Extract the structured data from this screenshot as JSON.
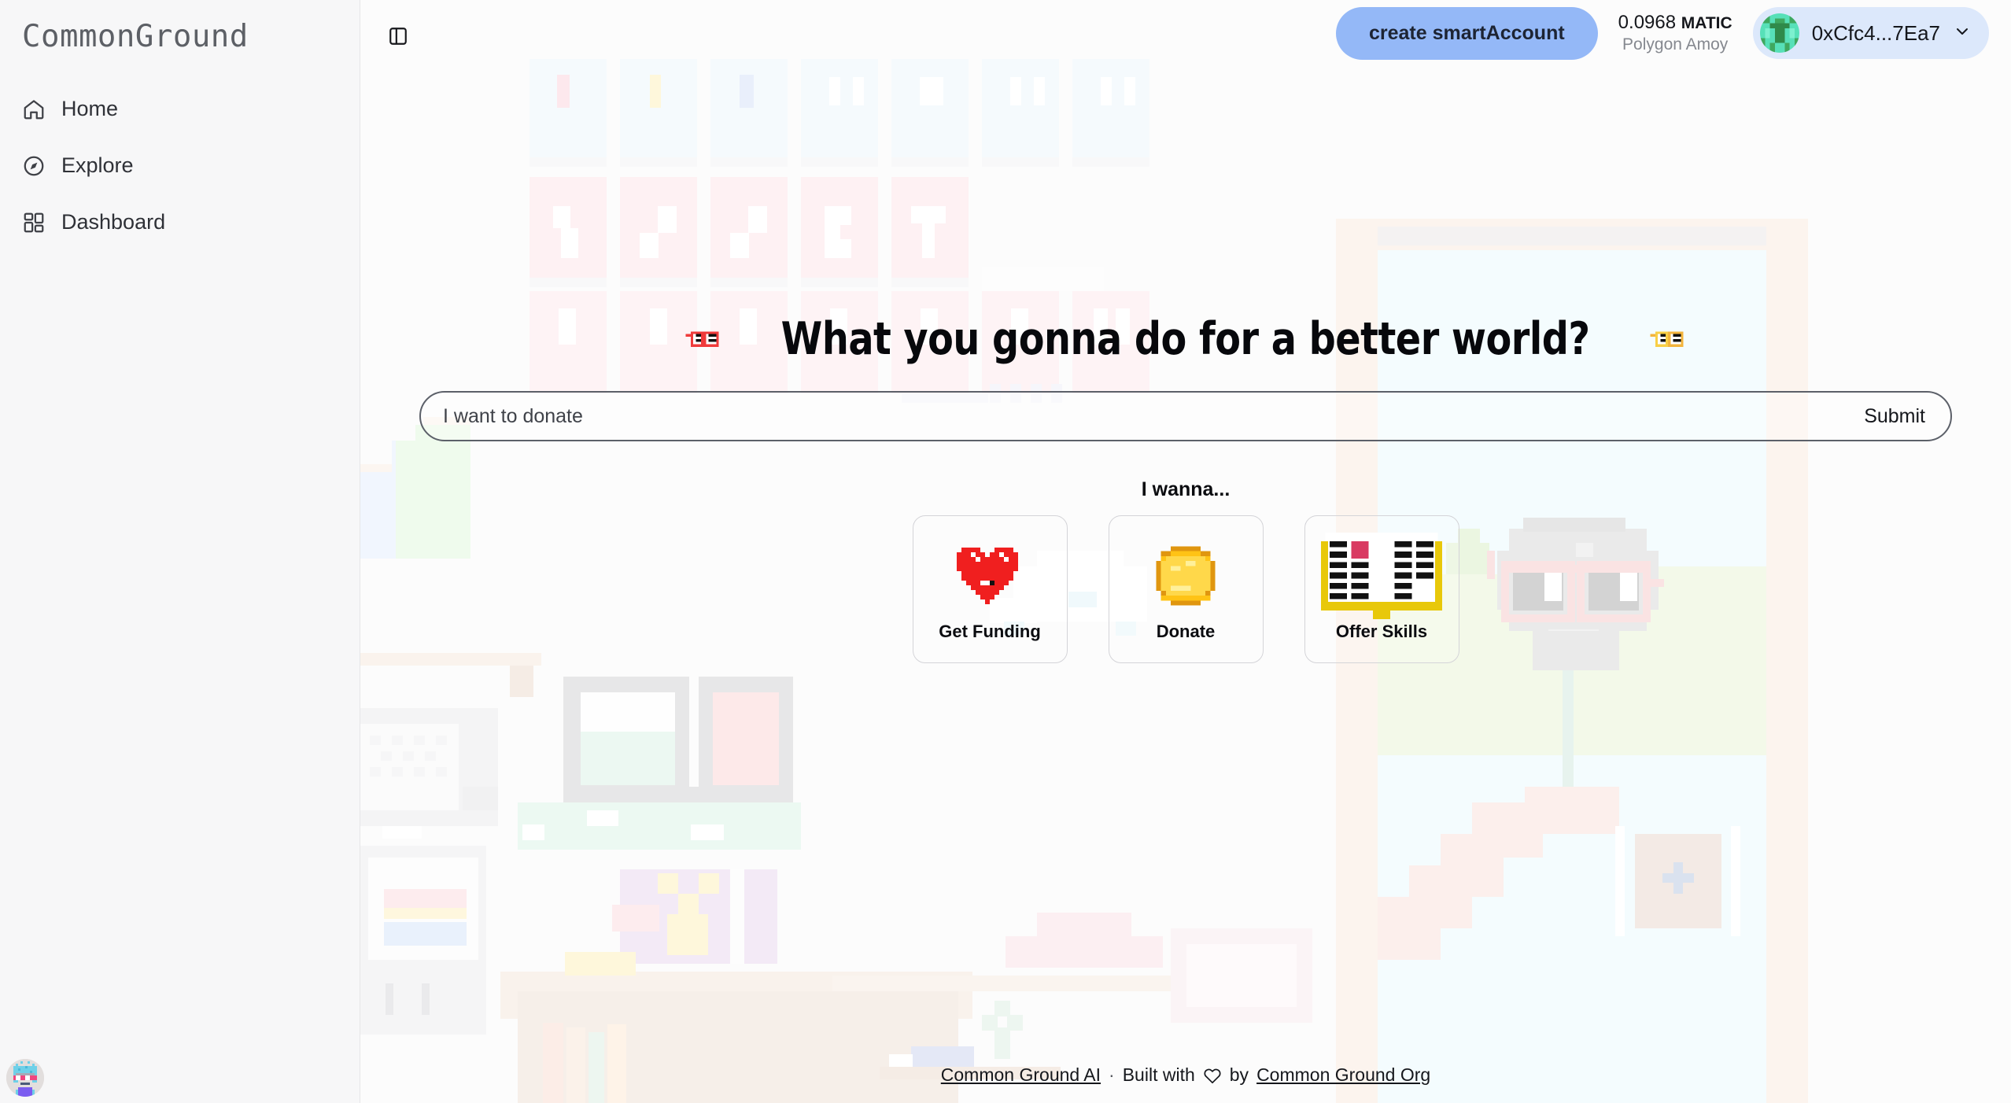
{
  "sidebar": {
    "brand": "CommonGround",
    "items": [
      {
        "label": "Home",
        "icon": "home-icon"
      },
      {
        "label": "Explore",
        "icon": "compass-icon"
      },
      {
        "label": "Dashboard",
        "icon": "grid-icon"
      }
    ],
    "corner_avatar_icon": "pixel-avatar-icon"
  },
  "topbar": {
    "panel_toggle_icon": "sidebar-toggle-icon",
    "create_account_label": "create smartAccount",
    "balance_amount": "0.0968",
    "balance_symbol": "MATIC",
    "network": "Polygon Amoy",
    "wallet_address": "0xCfc4...7Ea7",
    "wallet_avatar_icon": "blockie-avatar-icon",
    "chevron_icon": "chevron-down-icon"
  },
  "hero": {
    "headline": "What you gonna do for a better world?",
    "left_icon": "red-sunglasses-icon",
    "right_icon": "yellow-sunglasses-icon"
  },
  "search": {
    "placeholder": "I want to donate",
    "value": "",
    "submit_label": "Submit"
  },
  "actions": {
    "prompt": "I wanna...",
    "cards": [
      {
        "label": "Get Funding",
        "icon": "pixel-heart-icon"
      },
      {
        "label": "Donate",
        "icon": "pixel-coin-icon"
      },
      {
        "label": "Offer Skills",
        "icon": "pixel-open-book-icon"
      }
    ]
  },
  "footer": {
    "link_left": "Common Ground AI",
    "separator": "·",
    "built_with": "Built with",
    "heart_icon": "heart-outline-icon",
    "by": "by",
    "link_right": "Common Ground Org"
  },
  "colors": {
    "accent_blue": "#94b8f7",
    "wallet_pill": "#dce8fb",
    "heart_red": "#f01f1f",
    "coin_gold": "#ffc315",
    "book_yellow": "#e8c80a",
    "book_mark": "#d93a62",
    "page_bg": "#f7f7f8",
    "border_gray": "#d4d4d8"
  }
}
